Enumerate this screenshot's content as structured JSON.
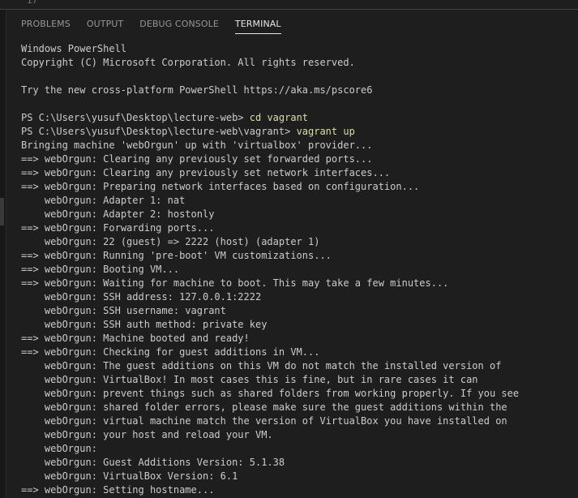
{
  "editor": {
    "line_number": "17"
  },
  "panel": {
    "tabs": [
      {
        "label": "PROBLEMS",
        "active": false
      },
      {
        "label": "OUTPUT",
        "active": false
      },
      {
        "label": "DEBUG CONSOLE",
        "active": false
      },
      {
        "label": "TERMINAL",
        "active": true
      }
    ]
  },
  "terminal": {
    "lines": [
      {
        "text": "Windows PowerShell"
      },
      {
        "text": "Copyright (C) Microsoft Corporation. All rights reserved."
      },
      {
        "text": ""
      },
      {
        "text": "Try the new cross-platform PowerShell https://aka.ms/pscore6"
      },
      {
        "text": ""
      },
      {
        "prompt": "PS C:\\Users\\yusuf\\Desktop\\lecture-web> ",
        "command": "cd vagrant"
      },
      {
        "prompt": "PS C:\\Users\\yusuf\\Desktop\\lecture-web\\vagrant> ",
        "command": "vagrant up"
      },
      {
        "text": "Bringing machine 'webOrgun' up with 'virtualbox' provider..."
      },
      {
        "text": "==> webOrgun: Clearing any previously set forwarded ports..."
      },
      {
        "text": "==> webOrgun: Clearing any previously set network interfaces..."
      },
      {
        "text": "==> webOrgun: Preparing network interfaces based on configuration..."
      },
      {
        "text": "    webOrgun: Adapter 1: nat"
      },
      {
        "text": "    webOrgun: Adapter 2: hostonly"
      },
      {
        "text": "==> webOrgun: Forwarding ports..."
      },
      {
        "text": "    webOrgun: 22 (guest) => 2222 (host) (adapter 1)"
      },
      {
        "text": "==> webOrgun: Running 'pre-boot' VM customizations..."
      },
      {
        "text": "==> webOrgun: Booting VM..."
      },
      {
        "text": "==> webOrgun: Waiting for machine to boot. This may take a few minutes..."
      },
      {
        "text": "    webOrgun: SSH address: 127.0.0.1:2222"
      },
      {
        "text": "    webOrgun: SSH username: vagrant"
      },
      {
        "text": "    webOrgun: SSH auth method: private key"
      },
      {
        "text": "==> webOrgun: Machine booted and ready!"
      },
      {
        "text": "==> webOrgun: Checking for guest additions in VM..."
      },
      {
        "text": "    webOrgun: The guest additions on this VM do not match the installed version of"
      },
      {
        "text": "    webOrgun: VirtualBox! In most cases this is fine, but in rare cases it can"
      },
      {
        "text": "    webOrgun: prevent things such as shared folders from working properly. If you see"
      },
      {
        "text": "    webOrgun: shared folder errors, please make sure the guest additions within the"
      },
      {
        "text": "    webOrgun: virtual machine match the version of VirtualBox you have installed on"
      },
      {
        "text": "    webOrgun: your host and reload your VM."
      },
      {
        "text": "    webOrgun:"
      },
      {
        "text": "    webOrgun: Guest Additions Version: 5.1.38"
      },
      {
        "text": "    webOrgun: VirtualBox Version: 6.1"
      },
      {
        "text": "==> webOrgun: Setting hostname..."
      }
    ]
  },
  "colors": {
    "background": "#1e1e1e",
    "text": "#cccccc",
    "command": "#dcdcaa",
    "active_tab": "#e7e7e7",
    "inactive_tab": "#969696"
  }
}
